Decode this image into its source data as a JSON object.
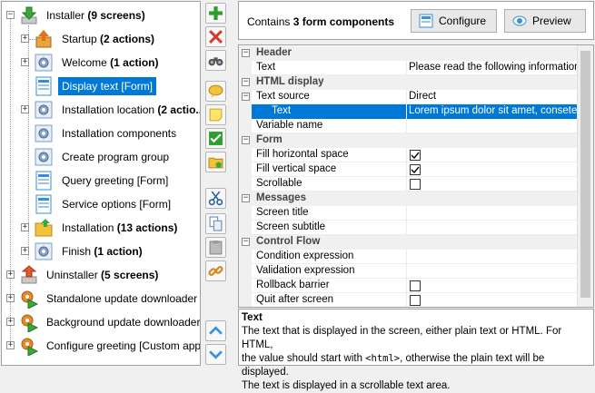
{
  "tree": {
    "items": [
      {
        "text": "Installer ",
        "bold": "(9 screens)",
        "icon": "installer-arrow-icon"
      },
      {
        "text": "Startup ",
        "bold": "(2 actions)",
        "icon": "startup-box-icon"
      },
      {
        "text": "Welcome ",
        "bold": "(1 action)",
        "icon": "gear-screen-icon"
      },
      {
        "text": "Display text [Form]",
        "bold": "",
        "icon": "form-icon"
      },
      {
        "text": "Installation location ",
        "bold": "(2 actio...",
        "icon": "gear-screen-icon"
      },
      {
        "text": "Installation components",
        "bold": "",
        "icon": "gear-screen-icon"
      },
      {
        "text": "Create program group",
        "bold": "",
        "icon": "gear-screen-icon"
      },
      {
        "text": "Query greeting [Form]",
        "bold": "",
        "icon": "form-icon"
      },
      {
        "text": "Service options [Form]",
        "bold": "",
        "icon": "form-icon"
      },
      {
        "text": "Installation ",
        "bold": "(13 actions)",
        "icon": "folder-icon"
      },
      {
        "text": "Finish ",
        "bold": "(1 action)",
        "icon": "gear-screen-icon"
      },
      {
        "text": "Uninstaller ",
        "bold": "(5 screens)",
        "icon": "uninstaller-arrow-icon"
      },
      {
        "text": "Standalone update downloader ...",
        "bold": "",
        "icon": "update-gear-icon"
      },
      {
        "text": "Background update downloader ...",
        "bold": "",
        "icon": "update-gear-icon"
      },
      {
        "text": "Configure greeting [Custom appl...",
        "bold": "",
        "icon": "update-gear-icon"
      }
    ]
  },
  "toolbar": {
    "buttons": [
      "add-icon",
      "delete-icon",
      "binoculars-icon",
      "comment-icon",
      "note-icon",
      "check-icon",
      "folder-gear-icon",
      "cut-icon",
      "copy-icon",
      "paste-icon",
      "link-icon",
      "move-up-icon",
      "move-down-icon"
    ]
  },
  "header": {
    "info_prefix": "Contains ",
    "info_bold": "3 form components",
    "configure_label": "Configure",
    "preview_label": "Preview"
  },
  "properties": {
    "header_cat": "Header",
    "text_label": "Text",
    "text_value": "Please read the following information:",
    "html_cat": "HTML display",
    "text_source_label": "Text source",
    "text_source_value": "Direct",
    "text_sub_label": "Text",
    "text_sub_value": "Lorem ipsum dolor sit amet, consetetur",
    "variable_name_label": "Variable name",
    "form_cat": "Form",
    "fill_h_label": "Fill horizontal space",
    "fill_v_label": "Fill vertical space",
    "scrollable_label": "Scrollable",
    "messages_cat": "Messages",
    "screen_title_label": "Screen title",
    "screen_subtitle_label": "Screen subtitle",
    "control_cat": "Control Flow",
    "condition_label": "Condition expression",
    "validation_label": "Validation expression",
    "rollback_label": "Rollback barrier",
    "quit_label": "Quit after screen"
  },
  "description": {
    "title": "Text",
    "line1": "The text that is displayed in the screen, either plain text or HTML. For HTML,",
    "line2a": "the value should start with ",
    "line2code": "<html>",
    "line2b": ", otherwise the plain text will be displayed.",
    "line3": "The text is displayed in a scrollable text area."
  },
  "colors": {
    "selection": "#0078d7",
    "add_green": "#2e9e2e",
    "delete_red": "#d63a2a",
    "nav_blue": "#3a8fd8"
  }
}
